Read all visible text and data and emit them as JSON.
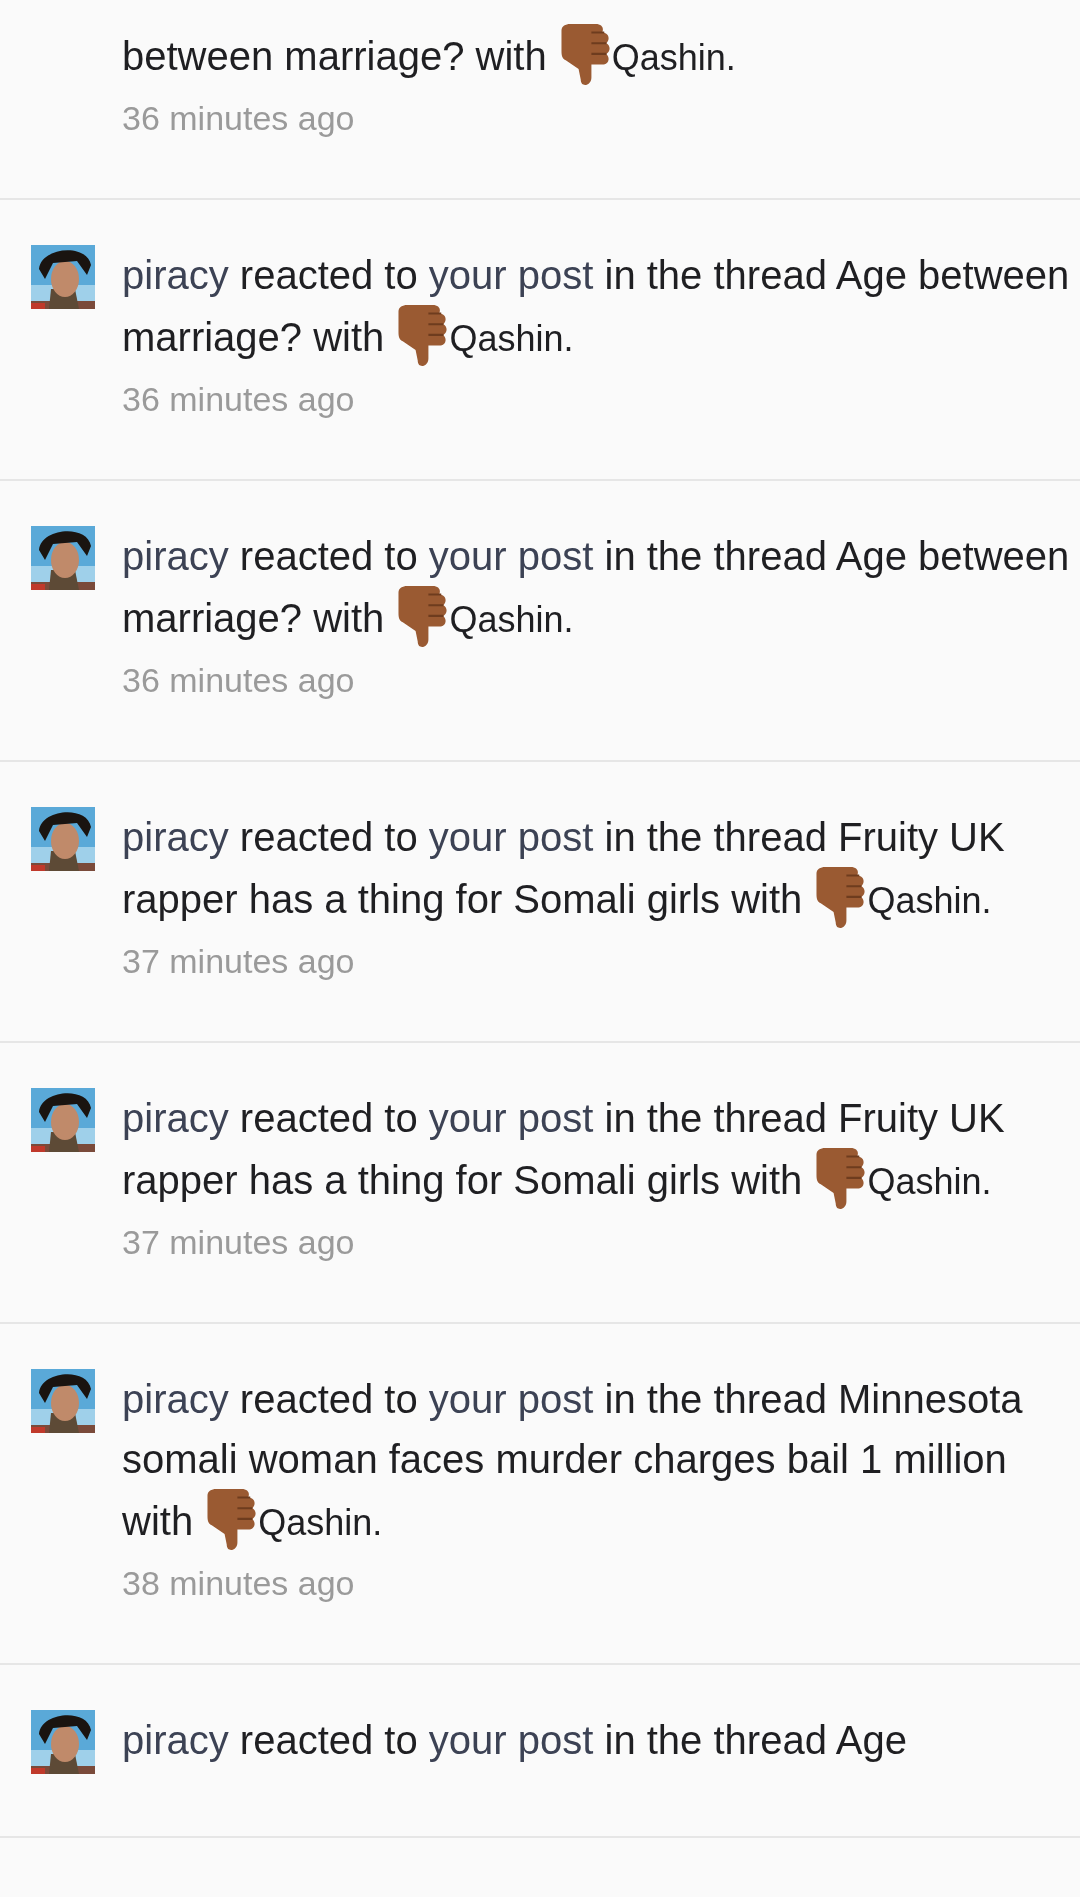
{
  "notifications": [
    {
      "context": "between marriage? with",
      "reaction": "Qashin.",
      "time": "36 minutes ago"
    },
    {
      "user": "piracy",
      "verb": "reacted to",
      "target": "your post",
      "context": "in the thread Age between marriage? with",
      "reaction": "Qashin.",
      "time": "36 minutes ago"
    },
    {
      "user": "piracy",
      "verb": "reacted to",
      "target": "your post",
      "context": "in the thread Age between marriage? with",
      "reaction": "Qashin.",
      "time": "36 minutes ago"
    },
    {
      "user": "piracy",
      "verb": "reacted to",
      "target": "your post",
      "context": "in the thread Fruity UK rapper has a thing for Somali girls with",
      "reaction": "Qashin.",
      "time": "37 minutes ago"
    },
    {
      "user": "piracy",
      "verb": "reacted to",
      "target": "your post",
      "context": "in the thread Fruity UK rapper has a thing for Somali girls with",
      "reaction": "Qashin.",
      "time": "37 minutes ago"
    },
    {
      "user": "piracy",
      "verb": "reacted to",
      "target": "your post",
      "context": "in the thread Minnesota somali woman faces murder charges bail 1 million with",
      "reaction": "Qashin.",
      "time": "38 minutes ago"
    },
    {
      "user": "piracy",
      "verb": "reacted to",
      "target": "your post",
      "context": "in the thread Age"
    }
  ]
}
